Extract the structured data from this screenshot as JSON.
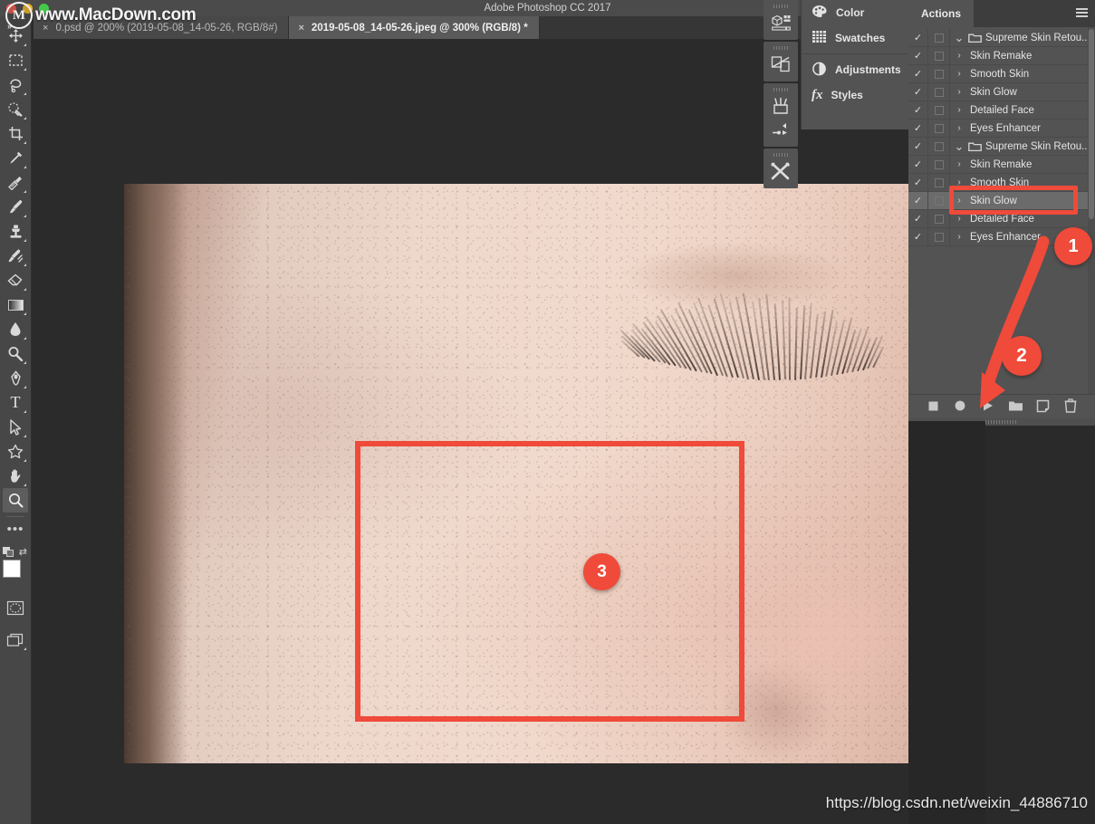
{
  "window": {
    "title": "Adobe Photoshop CC 2017",
    "traffic_lights": [
      "close",
      "minimize",
      "zoom"
    ]
  },
  "watermarks": {
    "top_left_brand": "www.MacDown.com",
    "top_left_logo_letter": "M",
    "bottom_right_url": "https://blog.csdn.net/weixin_44886710"
  },
  "tabs": [
    {
      "label": "0.psd @ 200% (2019-05-08_14-05-26, RGB/8#)",
      "active": false,
      "close": "×"
    },
    {
      "label": "2019-05-08_14-05-26.jpeg @ 300% (RGB/8) *",
      "active": true,
      "close": "×"
    }
  ],
  "toolbar": {
    "tools": [
      {
        "name": "move-tool",
        "icon": "move",
        "active": false,
        "has_flyout": true
      },
      {
        "name": "marquee-tool",
        "icon": "marquee",
        "active": false,
        "has_flyout": true
      },
      {
        "name": "lasso-tool",
        "icon": "lasso",
        "active": false,
        "has_flyout": true
      },
      {
        "name": "quick-selection-tool",
        "icon": "quick-select",
        "active": false,
        "has_flyout": true
      },
      {
        "name": "crop-tool",
        "icon": "crop",
        "active": false,
        "has_flyout": true
      },
      {
        "name": "eyedropper-tool",
        "icon": "eyedropper",
        "active": false,
        "has_flyout": true
      },
      {
        "name": "healing-brush-tool",
        "icon": "healing",
        "active": false,
        "has_flyout": true
      },
      {
        "name": "brush-tool",
        "icon": "brush",
        "active": false,
        "has_flyout": true
      },
      {
        "name": "clone-stamp-tool",
        "icon": "stamp",
        "active": false,
        "has_flyout": true
      },
      {
        "name": "history-brush-tool",
        "icon": "history-brush",
        "active": false,
        "has_flyout": true
      },
      {
        "name": "eraser-tool",
        "icon": "eraser",
        "active": false,
        "has_flyout": true
      },
      {
        "name": "gradient-tool",
        "icon": "gradient",
        "active": false,
        "has_flyout": true
      },
      {
        "name": "blur-tool",
        "icon": "blur",
        "active": false,
        "has_flyout": true
      },
      {
        "name": "dodge-tool",
        "icon": "dodge",
        "active": false,
        "has_flyout": true
      },
      {
        "name": "pen-tool",
        "icon": "pen",
        "active": false,
        "has_flyout": true
      },
      {
        "name": "type-tool",
        "icon": "type",
        "active": false,
        "has_flyout": true
      },
      {
        "name": "path-selection-tool",
        "icon": "path-select",
        "active": false,
        "has_flyout": true
      },
      {
        "name": "custom-shape-tool",
        "icon": "shape",
        "active": false,
        "has_flyout": true
      },
      {
        "name": "hand-tool",
        "icon": "hand",
        "active": false,
        "has_flyout": true
      },
      {
        "name": "zoom-tool",
        "icon": "zoom",
        "active": true,
        "has_flyout": false
      }
    ],
    "more_tools": "•••",
    "foreground_color": "#ffffff",
    "background_color": "#ffffff",
    "quick_mask": "quick-mask-mode",
    "screen_mode": "screen-mode"
  },
  "dock": {
    "groups": [
      {
        "icons": [
          "properties-3d-icon"
        ]
      },
      {
        "icons": [
          "libraries-icon"
        ]
      },
      {
        "icons": [
          "brushes-icon",
          "brush-settings-icon"
        ]
      },
      {
        "icons": [
          "tool-presets-icon"
        ]
      }
    ]
  },
  "flyout_panel": {
    "groups": [
      [
        {
          "label": "Color",
          "icon": "color-palette-icon"
        },
        {
          "label": "Swatches",
          "icon": "swatches-grid-icon"
        }
      ],
      [
        {
          "label": "Adjustments",
          "icon": "adjustments-half-circle-icon"
        },
        {
          "label": "Styles",
          "icon": "styles-fx-icon"
        }
      ]
    ]
  },
  "actions_panel": {
    "tab_label": "Actions",
    "menu_icon": "panel-menu-icon",
    "rows": [
      {
        "checked": true,
        "dialog_toggle": false,
        "type": "set",
        "expanded": true,
        "label": "Supreme Skin Retou...",
        "selected": false
      },
      {
        "checked": true,
        "dialog_toggle": false,
        "type": "action",
        "expanded": false,
        "label": "Skin Remake",
        "selected": false
      },
      {
        "checked": true,
        "dialog_toggle": false,
        "type": "action",
        "expanded": false,
        "label": "Smooth Skin",
        "selected": false
      },
      {
        "checked": true,
        "dialog_toggle": false,
        "type": "action",
        "expanded": false,
        "label": "Skin Glow",
        "selected": false
      },
      {
        "checked": true,
        "dialog_toggle": false,
        "type": "action",
        "expanded": false,
        "label": "Detailed Face",
        "selected": false
      },
      {
        "checked": true,
        "dialog_toggle": false,
        "type": "action",
        "expanded": false,
        "label": "Eyes Enhancer",
        "selected": false
      },
      {
        "checked": true,
        "dialog_toggle": false,
        "type": "set",
        "expanded": true,
        "label": "Supreme Skin Retou...",
        "selected": false
      },
      {
        "checked": true,
        "dialog_toggle": false,
        "type": "action",
        "expanded": false,
        "label": "Skin Remake",
        "selected": false
      },
      {
        "checked": true,
        "dialog_toggle": false,
        "type": "action",
        "expanded": false,
        "label": "Smooth Skin",
        "selected": false
      },
      {
        "checked": true,
        "dialog_toggle": false,
        "type": "action",
        "expanded": false,
        "label": "Skin Glow",
        "selected": true
      },
      {
        "checked": true,
        "dialog_toggle": false,
        "type": "action",
        "expanded": false,
        "label": "Detailed Face",
        "selected": false
      },
      {
        "checked": true,
        "dialog_toggle": false,
        "type": "action",
        "expanded": false,
        "label": "Eyes Enhancer",
        "selected": false
      }
    ],
    "check_glyph": "✓",
    "twist_glyph": "›",
    "expanded_glyph": "⌵",
    "footer_buttons": [
      {
        "name": "stop-button",
        "icon": "stop-square"
      },
      {
        "name": "record-button",
        "icon": "record-circle"
      },
      {
        "name": "play-button",
        "icon": "play-triangle"
      },
      {
        "name": "new-set-button",
        "icon": "folder"
      },
      {
        "name": "new-action-button",
        "icon": "new-page"
      },
      {
        "name": "delete-button",
        "icon": "trash"
      }
    ]
  },
  "annotations": {
    "badges": [
      {
        "number": "1",
        "target": "selected-action-row"
      },
      {
        "number": "2",
        "target": "play-button"
      },
      {
        "number": "3",
        "target": "skin-pore-region"
      }
    ],
    "highlight_color": "#ef4a3a",
    "selection_box_target": "Skin Glow",
    "arrow_from": "Skin Glow row",
    "arrow_to": "play-button"
  },
  "canvas": {
    "subject": "close-up-face-photo",
    "zoom_level": "300%"
  }
}
